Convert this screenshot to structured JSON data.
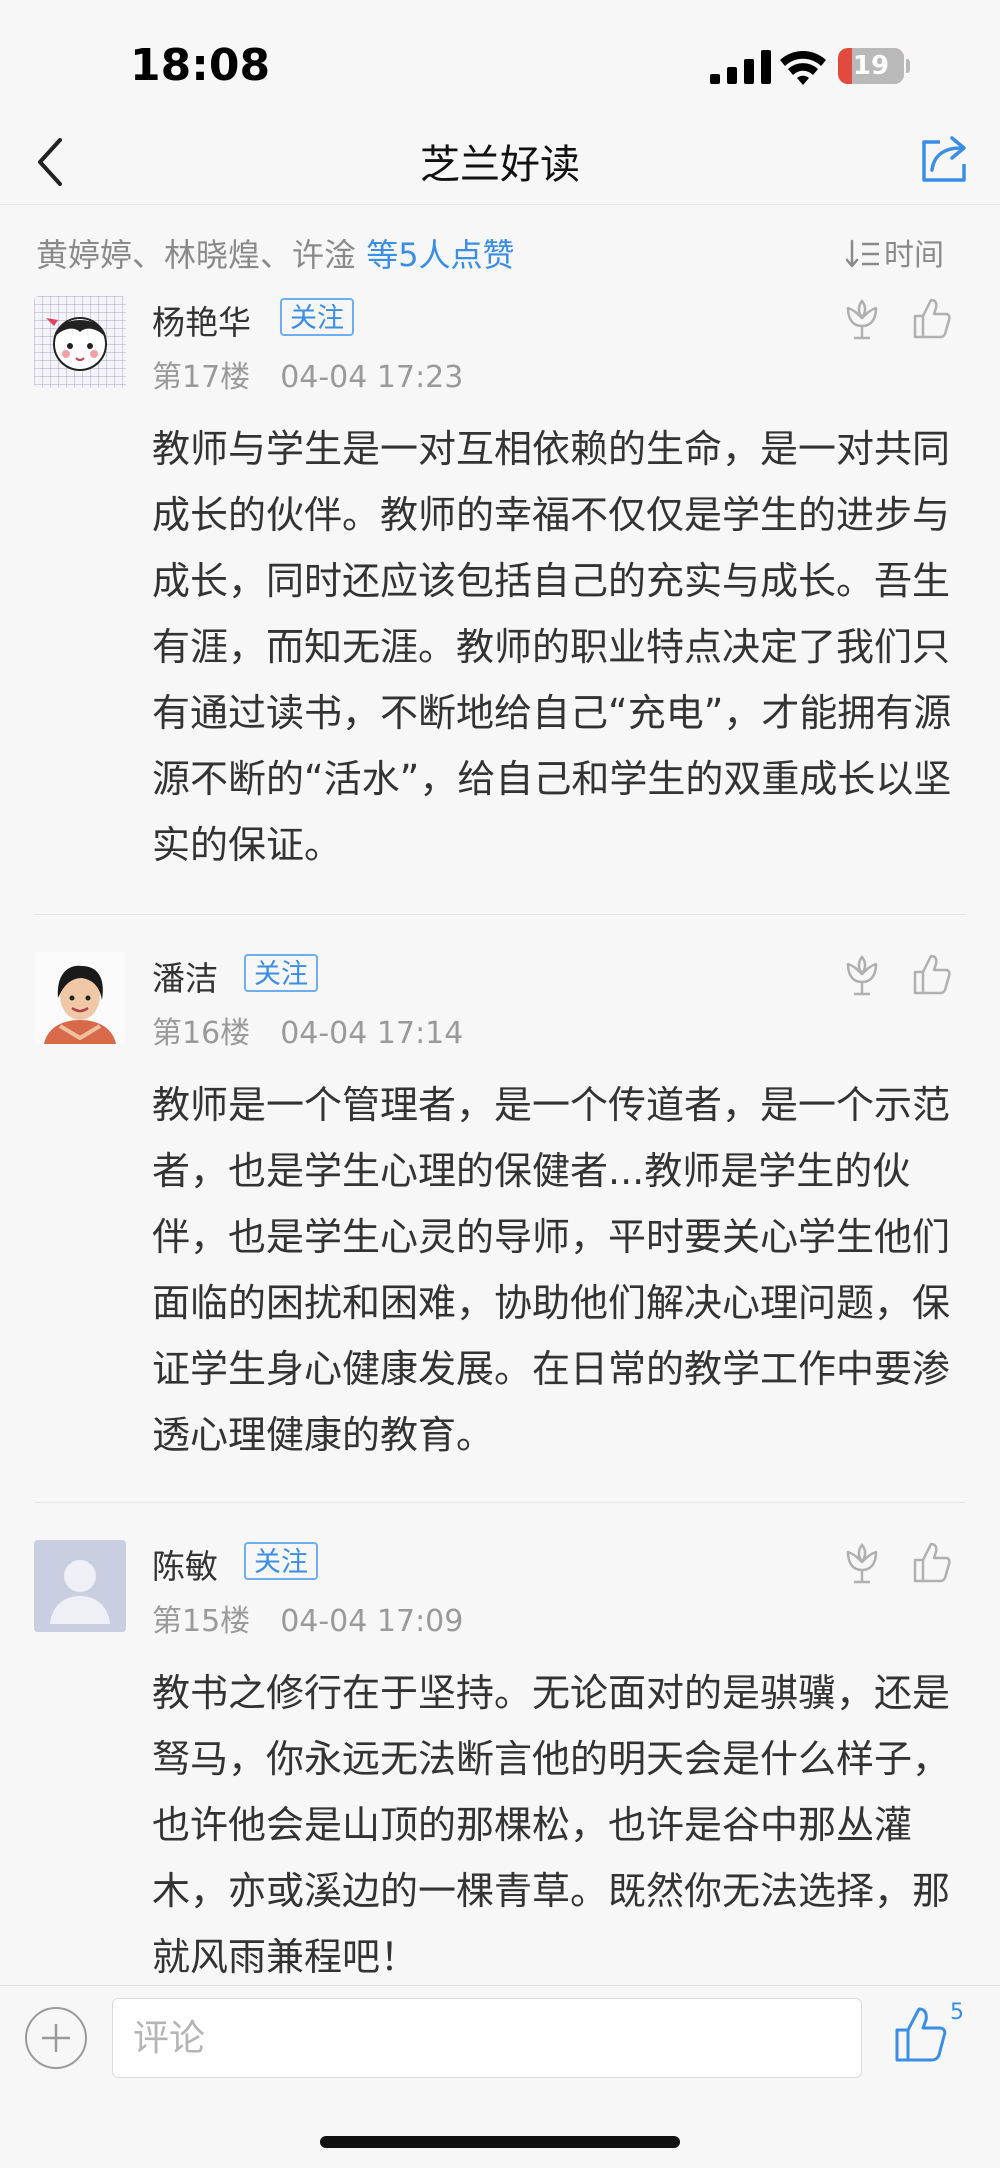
{
  "status_bar": {
    "time": "18:08",
    "battery": "19"
  },
  "nav": {
    "title": "芝兰好读"
  },
  "likes": {
    "names": "黄婷婷、林晓煌、许淦",
    "more": "等5人点赞"
  },
  "sort": {
    "label": "时间"
  },
  "comments": [
    {
      "name": "杨艳华",
      "follow": "关注",
      "floor": "第17楼",
      "time": "04-04 17:23",
      "content": "教师与学生是一对互相依赖的生命，是一对共同成长的伙伴。教师的幸福不仅仅是学生的进步与成长，同时还应该包括自己的充实与成长。吾生有涯，而知无涯。教师的职业特点决定了我们只有通过读书，不断地给自己“充电”，才能拥有源源不断的“活水”，给自己和学生的双重成长以坚实的保证。"
    },
    {
      "name": "潘洁",
      "follow": "关注",
      "floor": "第16楼",
      "time": "04-04 17:14",
      "content": "教师是一个管理者，是一个传道者，是一个示范者，也是学生心理的保健者...教师是学生的伙伴，也是学生心灵的导师，平时要关心学生他们面临的困扰和困难，协助他们解决心理问题，保证学生身心健康发展。在日常的教学工作中要渗透心理健康的教育。"
    },
    {
      "name": "陈敏",
      "follow": "关注",
      "floor": "第15楼",
      "time": "04-04 17:09",
      "content": "教书之修行在于坚持。无论面对的是骐骥，还是驽马，你永远无法断言他的明天会是什么样子，也许他会是山顶的那棵松，也许是谷中那丛灌木，亦或溪边的一棵青草。既然你无法选择，那就风雨兼程吧！"
    }
  ],
  "bottom_bar": {
    "placeholder": "评论",
    "like_count": "5"
  },
  "icons": {
    "back": "chevron-left-icon",
    "share": "share-icon",
    "sort": "sort-icon",
    "flower": "flower-icon",
    "thumb": "thumb-up-icon",
    "plus": "plus-icon"
  },
  "colors": {
    "accent": "#3a8ee6",
    "battery_low": "#e14a3c",
    "background": "#f7f7f7"
  }
}
